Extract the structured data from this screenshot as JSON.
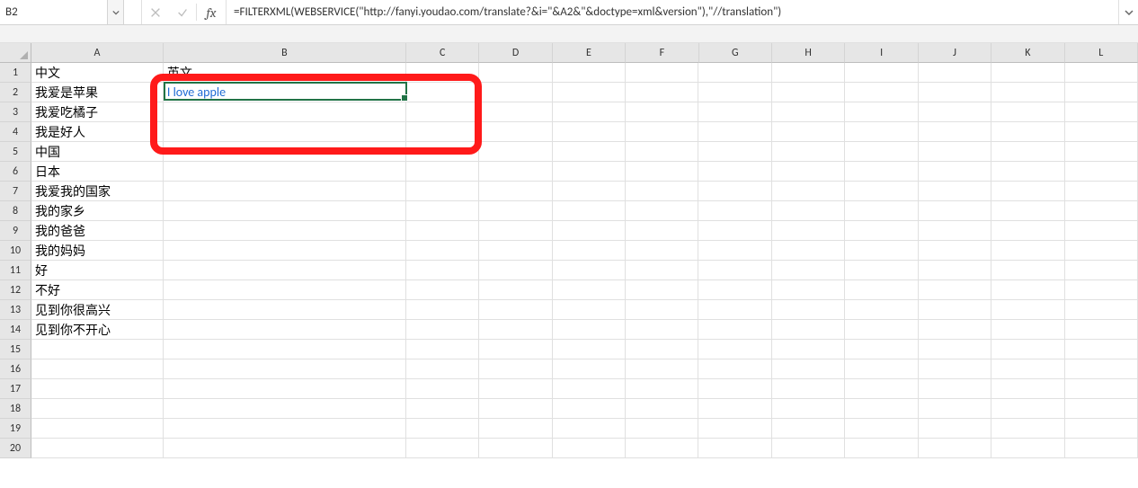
{
  "name_box": {
    "value": "B2"
  },
  "formula_bar": {
    "formula": "=FILTERXML(WEBSERVICE(\"http://fanyi.youdao.com/translate?&i=\"&A2&\"&doctype=xml&version\"),\"//translation\")",
    "fx_label": "fx"
  },
  "columns": [
    "A",
    "B",
    "C",
    "D",
    "E",
    "F",
    "G",
    "H",
    "I",
    "J",
    "K",
    "L"
  ],
  "row_count": 20,
  "cells": {
    "A1": "中文",
    "B1": "英文",
    "A2": "我爱是苹果",
    "B2": "I love apple",
    "A3": "我爱吃橘子",
    "A4": "我是好人",
    "A5": "中国",
    "A6": "日本",
    "A7": "我爱我的国家",
    "A8": "我的家乡",
    "A9": "我的爸爸",
    "A10": "我的妈妈",
    "A11": "好",
    "A12": "不好",
    "A13": "见到你很高兴",
    "A14": "见到你不开心"
  },
  "active_cell": "B2"
}
